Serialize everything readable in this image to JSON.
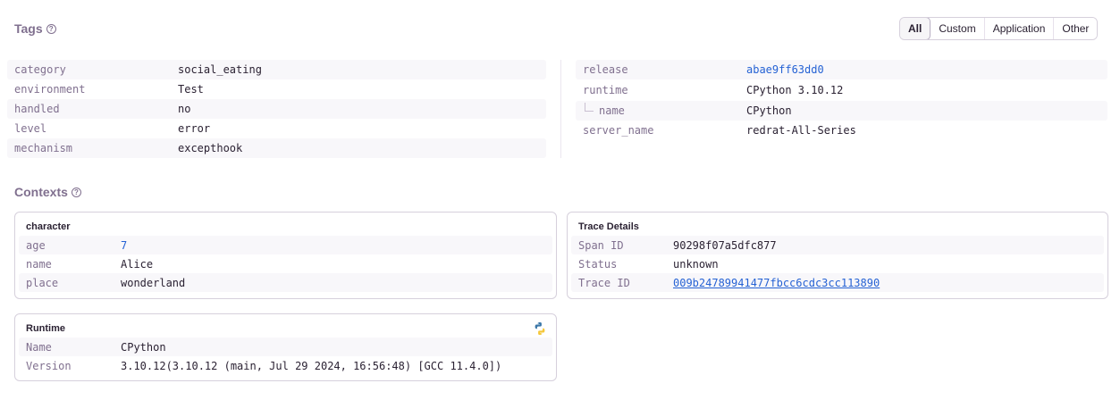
{
  "tags": {
    "title": "Tags",
    "filters": [
      "All",
      "Custom",
      "Application",
      "Other"
    ],
    "active_filter": "All",
    "left": [
      {
        "key": "category",
        "value": "social_eating"
      },
      {
        "key": "environment",
        "value": "Test"
      },
      {
        "key": "handled",
        "value": "no"
      },
      {
        "key": "level",
        "value": "error"
      },
      {
        "key": "mechanism",
        "value": "excepthook"
      }
    ],
    "right": [
      {
        "key": "release",
        "value": "abae9ff63dd0"
      },
      {
        "key": "runtime",
        "value": "CPython 3.10.12"
      },
      {
        "key": "name",
        "value": "CPython"
      },
      {
        "key": "server_name",
        "value": "redrat-All-Series"
      }
    ]
  },
  "contexts": {
    "title": "Contexts",
    "character": {
      "title": "character",
      "rows": [
        {
          "key": "age",
          "value": "7"
        },
        {
          "key": "name",
          "value": "Alice"
        },
        {
          "key": "place",
          "value": "wonderland"
        }
      ]
    },
    "trace": {
      "title": "Trace Details",
      "rows": [
        {
          "key": "Span ID",
          "value": "90298f07a5dfc877"
        },
        {
          "key": "Status",
          "value": "unknown"
        },
        {
          "key": "Trace ID",
          "value": "009b24789941477fbcc6cdc3cc113890"
        }
      ]
    },
    "runtime": {
      "title": "Runtime",
      "icon": "python-icon",
      "rows": [
        {
          "key": "Name",
          "value": "CPython"
        },
        {
          "key": "Version",
          "value": "3.10.12(3.10.12 (main, Jul 29 2024, 16:56:48) [GCC 11.4.0])"
        }
      ]
    }
  },
  "colors": {
    "link": "#2562d4",
    "muted": "#80708f",
    "text": "#2b2233"
  }
}
